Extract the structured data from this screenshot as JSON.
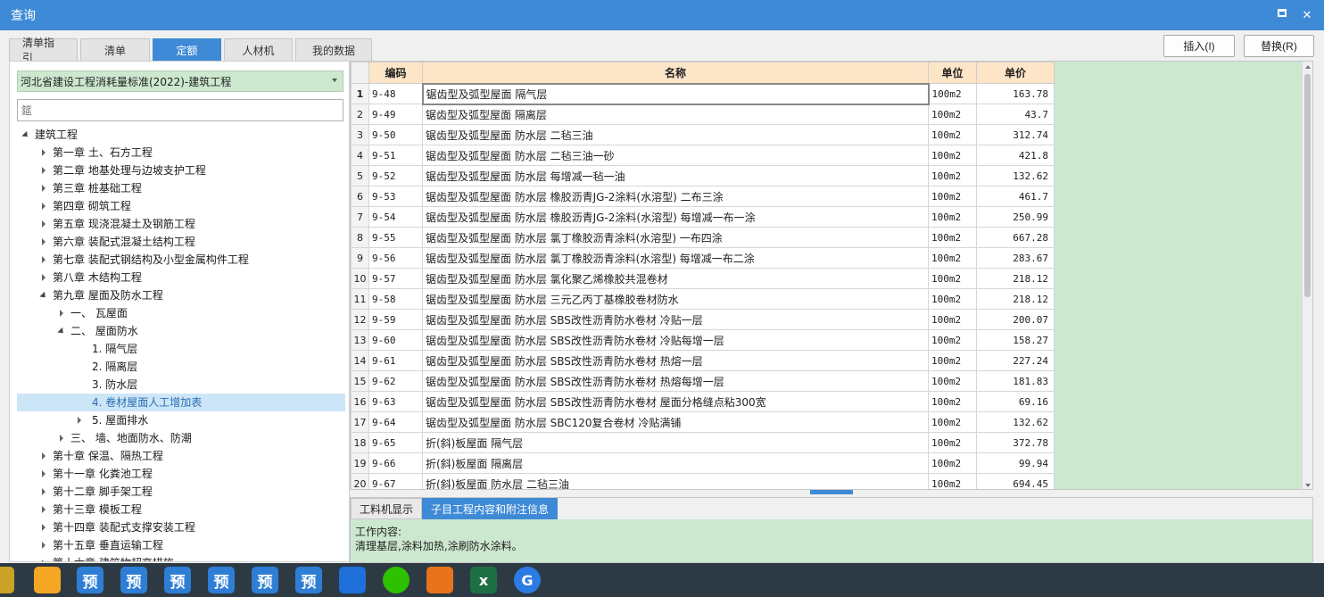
{
  "window": {
    "title": "查询"
  },
  "tabs": [
    "清单指引",
    "清单",
    "定额",
    "人材机",
    "我的数据"
  ],
  "active_tab": 2,
  "actions": {
    "insert": "插入(I)",
    "replace": "替换(R)"
  },
  "library_select": "河北省建设工程消耗量标准(2022)-建筑工程",
  "search": {
    "placeholder": "筵"
  },
  "tree": [
    {
      "label": "建筑工程",
      "level": 0,
      "state": "down"
    },
    {
      "label": "第一章 土、石方工程",
      "level": 1,
      "state": "right"
    },
    {
      "label": "第二章 地基处理与边坡支护工程",
      "level": 1,
      "state": "right"
    },
    {
      "label": "第三章 桩基础工程",
      "level": 1,
      "state": "right"
    },
    {
      "label": "第四章 砌筑工程",
      "level": 1,
      "state": "right"
    },
    {
      "label": "第五章 现浇混凝土及钢筋工程",
      "level": 1,
      "state": "right"
    },
    {
      "label": "第六章 装配式混凝土结构工程",
      "level": 1,
      "state": "right"
    },
    {
      "label": "第七章 装配式钢结构及小型金属构件工程",
      "level": 1,
      "state": "right"
    },
    {
      "label": "第八章 木结构工程",
      "level": 1,
      "state": "right"
    },
    {
      "label": "第九章 屋面及防水工程",
      "level": 1,
      "state": "down"
    },
    {
      "label": "一、 瓦屋面",
      "level": 2,
      "state": "right"
    },
    {
      "label": "二、 屋面防水",
      "level": 2,
      "state": "down"
    },
    {
      "label": "1. 隔气层",
      "level": 3,
      "state": "none"
    },
    {
      "label": "2. 隔离层",
      "level": 3,
      "state": "none"
    },
    {
      "label": "3. 防水层",
      "level": 3,
      "state": "none"
    },
    {
      "label": "4. 卷材屋面人工增加表",
      "level": 3,
      "state": "none",
      "selected": true
    },
    {
      "label": "5. 屋面排水",
      "level": 3,
      "state": "right"
    },
    {
      "label": "三、 墙、地面防水、防潮",
      "level": 2,
      "state": "right"
    },
    {
      "label": "第十章 保温、隔热工程",
      "level": 1,
      "state": "right"
    },
    {
      "label": "第十一章 化粪池工程",
      "level": 1,
      "state": "right"
    },
    {
      "label": "第十二章 脚手架工程",
      "level": 1,
      "state": "right"
    },
    {
      "label": "第十三章 模板工程",
      "level": 1,
      "state": "right"
    },
    {
      "label": "第十四章 装配式支撑安装工程",
      "level": 1,
      "state": "right"
    },
    {
      "label": "第十五章 垂直运输工程",
      "level": 1,
      "state": "right"
    },
    {
      "label": "第十六章 建筑物超高措施",
      "level": 1,
      "state": "right"
    }
  ],
  "grid": {
    "columns": {
      "code": "编码",
      "name": "名称",
      "unit": "单位",
      "price": "单价"
    },
    "rows": [
      {
        "n": "1",
        "code": "9-48",
        "name": "锯齿型及弧型屋面 隔气层",
        "unit": "100m2",
        "price": "163.78"
      },
      {
        "n": "2",
        "code": "9-49",
        "name": "锯齿型及弧型屋面 隔离层",
        "unit": "100m2",
        "price": "43.7"
      },
      {
        "n": "3",
        "code": "9-50",
        "name": "锯齿型及弧型屋面 防水层 二毡三油",
        "unit": "100m2",
        "price": "312.74"
      },
      {
        "n": "4",
        "code": "9-51",
        "name": "锯齿型及弧型屋面 防水层 二毡三油一砂",
        "unit": "100m2",
        "price": "421.8"
      },
      {
        "n": "5",
        "code": "9-52",
        "name": "锯齿型及弧型屋面 防水层 每增减一毡一油",
        "unit": "100m2",
        "price": "132.62"
      },
      {
        "n": "6",
        "code": "9-53",
        "name": "锯齿型及弧型屋面 防水层 橡胶沥青JG-2涂料(水溶型) 二布三涂",
        "unit": "100m2",
        "price": "461.7"
      },
      {
        "n": "7",
        "code": "9-54",
        "name": "锯齿型及弧型屋面 防水层 橡胶沥青JG-2涂料(水溶型) 每增减一布一涂",
        "unit": "100m2",
        "price": "250.99"
      },
      {
        "n": "8",
        "code": "9-55",
        "name": "锯齿型及弧型屋面 防水层 氯丁橡胶沥青涂料(水溶型) 一布四涂",
        "unit": "100m2",
        "price": "667.28"
      },
      {
        "n": "9",
        "code": "9-56",
        "name": "锯齿型及弧型屋面 防水层 氯丁橡胶沥青涂料(水溶型) 每增减一布二涂",
        "unit": "100m2",
        "price": "283.67"
      },
      {
        "n": "10",
        "code": "9-57",
        "name": "锯齿型及弧型屋面 防水层 氯化聚乙烯橡胶共混卷材",
        "unit": "100m2",
        "price": "218.12"
      },
      {
        "n": "11",
        "code": "9-58",
        "name": "锯齿型及弧型屋面 防水层 三元乙丙丁基橡胶卷材防水",
        "unit": "100m2",
        "price": "218.12"
      },
      {
        "n": "12",
        "code": "9-59",
        "name": "锯齿型及弧型屋面 防水层 SBS改性沥青防水卷材 冷贴一层",
        "unit": "100m2",
        "price": "200.07"
      },
      {
        "n": "13",
        "code": "9-60",
        "name": "锯齿型及弧型屋面 防水层 SBS改性沥青防水卷材 冷贴每增一层",
        "unit": "100m2",
        "price": "158.27"
      },
      {
        "n": "14",
        "code": "9-61",
        "name": "锯齿型及弧型屋面 防水层 SBS改性沥青防水卷材 热熔一层",
        "unit": "100m2",
        "price": "227.24"
      },
      {
        "n": "15",
        "code": "9-62",
        "name": "锯齿型及弧型屋面 防水层 SBS改性沥青防水卷材 热熔每增一层",
        "unit": "100m2",
        "price": "181.83"
      },
      {
        "n": "16",
        "code": "9-63",
        "name": "锯齿型及弧型屋面 防水层 SBS改性沥青防水卷材 屋面分格缝点粘300宽",
        "unit": "100m2",
        "price": "69.16"
      },
      {
        "n": "17",
        "code": "9-64",
        "name": "锯齿型及弧型屋面 防水层 SBC120复合卷材 冷贴满铺",
        "unit": "100m2",
        "price": "132.62"
      },
      {
        "n": "18",
        "code": "9-65",
        "name": "折(斜)板屋面 隔气层",
        "unit": "100m2",
        "price": "372.78"
      },
      {
        "n": "19",
        "code": "9-66",
        "name": "折(斜)板屋面 隔离层",
        "unit": "100m2",
        "price": "99.94"
      },
      {
        "n": "20",
        "code": "9-67",
        "name": "折(斜)板屋面 防水层 二毡三油",
        "unit": "100m2",
        "price": "694.45"
      }
    ]
  },
  "bottom": {
    "tabs": [
      "工料机显示",
      "子目工程内容和附注信息"
    ],
    "active_tab": 1,
    "content_title": "工作内容:",
    "content_text": "清理基层,涂料加热,涂刷防水涂料。"
  },
  "taskbar": {
    "items": [
      {
        "icon": "app-icon",
        "glyph": ""
      },
      {
        "icon": "cloud-app-icon",
        "glyph": ""
      },
      {
        "icon": "yu-app-icon",
        "glyph": "预"
      },
      {
        "icon": "yu-app-icon",
        "glyph": "预"
      },
      {
        "icon": "yu-app-icon",
        "glyph": "预"
      },
      {
        "icon": "yu-app-icon",
        "glyph": "预"
      },
      {
        "icon": "yu-app-icon",
        "glyph": "预"
      },
      {
        "icon": "yu-app-icon",
        "glyph": "预"
      },
      {
        "icon": "send-app-icon",
        "glyph": ""
      },
      {
        "icon": "wechat-icon",
        "glyph": ""
      },
      {
        "icon": "orange-app-icon",
        "glyph": ""
      },
      {
        "icon": "excel-icon",
        "glyph": "x"
      },
      {
        "icon": "g-app-icon",
        "glyph": "G"
      }
    ]
  }
}
